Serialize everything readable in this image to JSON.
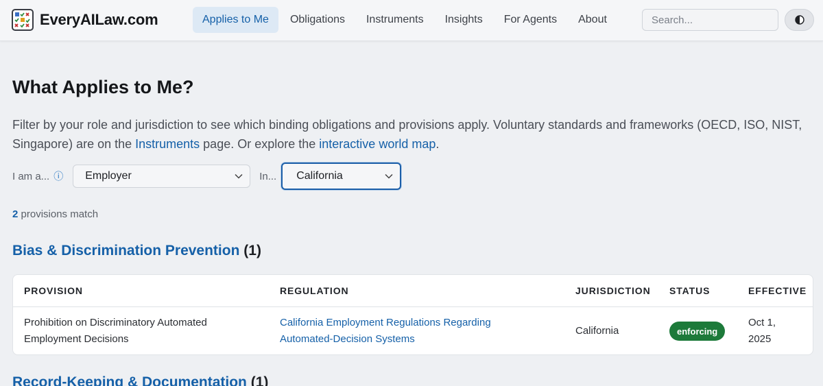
{
  "brand": {
    "name": "EveryAILaw.com",
    "logo_icon": "checklist-grid-icon"
  },
  "nav": {
    "items": [
      {
        "label": "Applies to Me",
        "active": true
      },
      {
        "label": "Obligations"
      },
      {
        "label": "Instruments"
      },
      {
        "label": "Insights"
      },
      {
        "label": "For Agents"
      },
      {
        "label": "About"
      }
    ]
  },
  "search": {
    "placeholder": "Search...",
    "value": ""
  },
  "theme_toggle": {
    "icon": "half-moon-icon"
  },
  "page": {
    "title": "What Applies to Me?",
    "intro_before": "Filter by your role and jurisdiction to see which binding obligations and provisions apply. Voluntary standards and frameworks (OECD, ISO, NIST, Singapore) are on the ",
    "intro_link1": "Instruments",
    "intro_middle": " page. Or explore the ",
    "intro_link2": "interactive world map",
    "intro_after": "."
  },
  "filters": {
    "role_label": "I am a...",
    "role_value": "Employer",
    "in_label": "In...",
    "jurisdiction_value": "California"
  },
  "results": {
    "count": "2",
    "suffix": " provisions match"
  },
  "sections": [
    {
      "name": "Bias & Discrimination Prevention",
      "count": "(1)",
      "columns": [
        "PROVISION",
        "REGULATION",
        "JURISDICTION",
        "STATUS",
        "EFFECTIVE"
      ],
      "rows": [
        {
          "provision_line1": "Prohibition on Discriminatory Automated",
          "provision_line2": "Employment Decisions",
          "regulation_line1": "California Employment Regulations Regarding",
          "regulation_line2": "Automated-Decision Systems",
          "jurisdiction": "California",
          "status": "enforcing",
          "effective_line1": "Oct 1,",
          "effective_line2": "2025"
        }
      ]
    },
    {
      "name": "Record-Keeping & Documentation",
      "count": "(1)"
    }
  ],
  "colors": {
    "accent": "#1560a8",
    "status_enforcing": "#1d7a3a",
    "background": "#eef0f3"
  }
}
